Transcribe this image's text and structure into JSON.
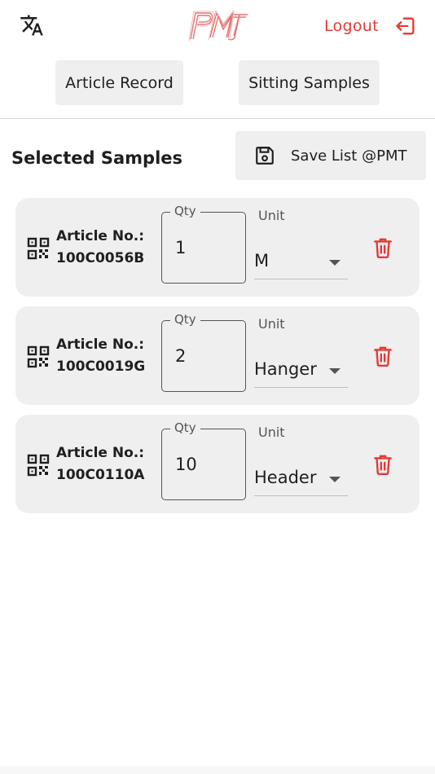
{
  "header": {
    "translate_icon": "translate-icon",
    "logo_icon": "brand-logo",
    "logout_label": "Logout",
    "logout_icon": "logout-icon"
  },
  "nav": {
    "article_record": "Article Record",
    "sitting_samples": "Sitting Samples"
  },
  "samples": {
    "title": "Selected Samples",
    "save_label": "Save List @PMT",
    "save_icon": "save-icon",
    "article_prefix": "Article No.:",
    "qty_label": "Qty",
    "unit_label": "Unit",
    "items": [
      {
        "article_no": "100C0056B",
        "qty": "1",
        "unit": "M"
      },
      {
        "article_no": "100C0019G",
        "qty": "2",
        "unit": "Hanger"
      },
      {
        "article_no": "100C0110A",
        "qty": "10",
        "unit": "Header"
      }
    ]
  },
  "colors": {
    "accent_red": "#e53935",
    "surface_grey": "#efefef",
    "text_dark": "#1f1f1f"
  }
}
